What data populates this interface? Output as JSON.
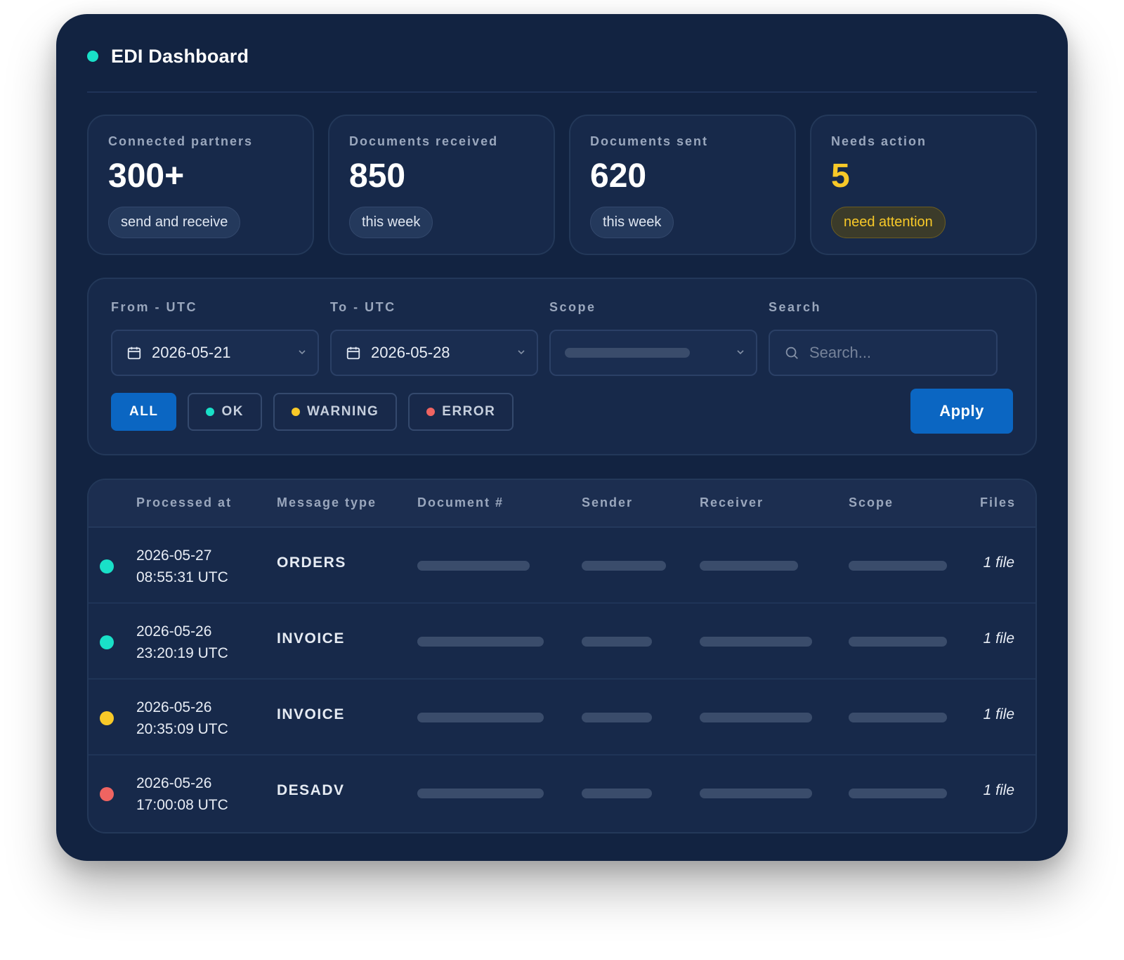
{
  "app": {
    "title": "EDI Dashboard",
    "status_color": "#19e0c8"
  },
  "stats": [
    {
      "label": "Connected partners",
      "value": "300+",
      "pill": "send and receive"
    },
    {
      "label": "Documents received",
      "value": "850",
      "pill": "this week"
    },
    {
      "label": "Documents sent",
      "value": "620",
      "pill": "this week"
    },
    {
      "label": "Needs action",
      "value": "5",
      "pill": "need attention",
      "accent": "#f8c928"
    }
  ],
  "filters": {
    "from_label": "From - UTC",
    "from_value": "2026-05-21",
    "to_label": "To - UTC",
    "to_value": "2026-05-28",
    "scope_label": "Scope",
    "search_label": "Search",
    "search_placeholder": "Search...",
    "chips": [
      {
        "label": "ALL",
        "active": true
      },
      {
        "label": "OK",
        "color": "#19e0c8"
      },
      {
        "label": "WARNING",
        "color": "#f8c928"
      },
      {
        "label": "ERROR",
        "color": "#ef6461"
      }
    ],
    "apply_label": "Apply"
  },
  "table": {
    "columns": [
      "Processed at",
      "Message type",
      "Document #",
      "Sender",
      "Receiver",
      "Scope",
      "Files"
    ],
    "rows": [
      {
        "status": "ok",
        "status_color": "#19e0c8",
        "date": "2026-05-27",
        "time": "08:55:31 UTC",
        "type": "ORDERS",
        "files": "1 file"
      },
      {
        "status": "ok",
        "status_color": "#19e0c8",
        "date": "2026-05-26",
        "time": "23:20:19 UTC",
        "type": "INVOICE",
        "files": "1 file"
      },
      {
        "status": "warning",
        "status_color": "#f8c928",
        "date": "2026-05-26",
        "time": "20:35:09 UTC",
        "type": "INVOICE",
        "files": "1 file"
      },
      {
        "status": "error",
        "status_color": "#ef6461",
        "date": "2026-05-26",
        "time": "17:00:08 UTC",
        "type": "DESADV",
        "files": "1 file"
      }
    ]
  }
}
